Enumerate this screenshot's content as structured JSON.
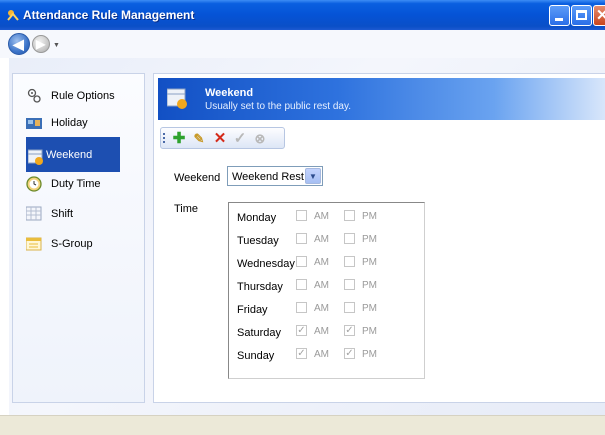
{
  "window": {
    "title": "Attendance Rule Management",
    "close_glyph": "✕"
  },
  "nav": {
    "back_glyph": "◀",
    "forward_glyph": "▶",
    "dropdown_glyph": "▼"
  },
  "sidebar": {
    "items": [
      {
        "label": "Rule Options",
        "icon": "rule-options-icon"
      },
      {
        "label": "Holiday",
        "icon": "holiday-icon"
      },
      {
        "label": "Weekend",
        "icon": "weekend-icon",
        "selected": true
      },
      {
        "label": "Duty Time",
        "icon": "clock-icon"
      },
      {
        "label": "Shift",
        "icon": "shift-grid-icon"
      },
      {
        "label": "S-Group",
        "icon": "group-icon"
      }
    ]
  },
  "header": {
    "title": "Weekend",
    "subtitle": "Usually set to the public rest day."
  },
  "toolbar": {
    "add_glyph": "✚",
    "edit_glyph": "✎",
    "delete_glyph": "✕",
    "ok_glyph": "✓",
    "cancel_glyph": "⊗"
  },
  "form": {
    "weekend_label": "Weekend",
    "weekend_value": "Weekend Rest",
    "dropdown_glyph": "▼",
    "time_label": "Time",
    "am_label": "AM",
    "pm_label": "PM",
    "check_glyph": "✓",
    "days": [
      {
        "name": "Monday",
        "am": false,
        "pm": false
      },
      {
        "name": "Tuesday",
        "am": false,
        "pm": false
      },
      {
        "name": "Wednesday",
        "am": false,
        "pm": false
      },
      {
        "name": "Thursday",
        "am": false,
        "pm": false
      },
      {
        "name": "Friday",
        "am": false,
        "pm": false
      },
      {
        "name": "Saturday",
        "am": true,
        "pm": true
      },
      {
        "name": "Sunday",
        "am": true,
        "pm": true
      }
    ]
  },
  "colors": {
    "titlebar": "#0553d6",
    "selected": "#1d4fb1",
    "header": "#1250c4"
  }
}
